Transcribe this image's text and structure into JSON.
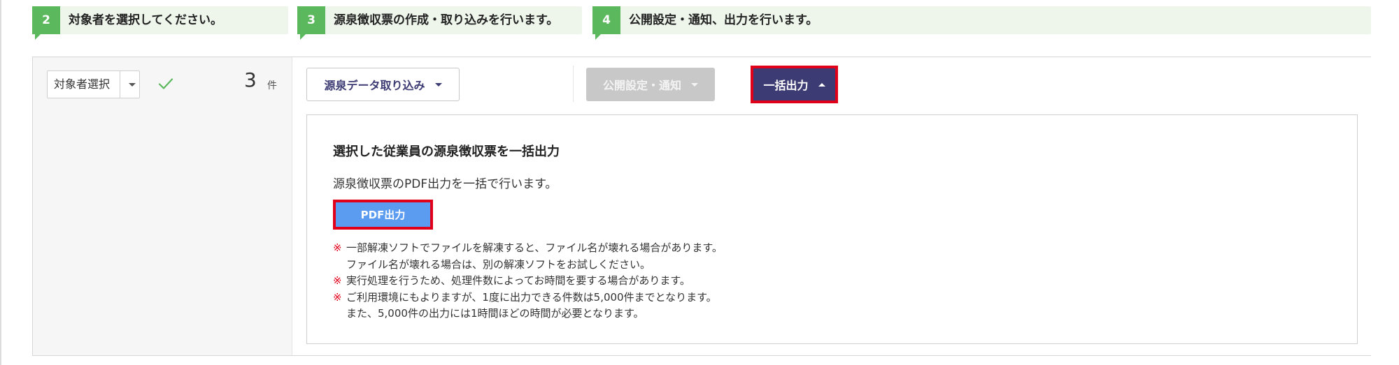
{
  "steps": [
    {
      "num": "2",
      "label": "対象者を選択してください。"
    },
    {
      "num": "3",
      "label": "源泉徴収票の作成・取り込みを行います。"
    },
    {
      "num": "4",
      "label": "公開設定・通知、出力を行います。"
    }
  ],
  "left": {
    "select_label": "対象者選択",
    "count": "3",
    "count_unit": "件"
  },
  "toolbar": {
    "import_label": "源泉データ取り込み",
    "publish_label": "公開設定・通知",
    "bulk_label": "一括出力"
  },
  "panel": {
    "title": "選択した従業員の源泉徴収票を一括出力",
    "description": "源泉徴収票のPDF出力を一括で行います。",
    "pdf_button": "PDF出力",
    "note_mark": "※",
    "notes": [
      "一部解凍ソフトでファイルを解凍すると、ファイル名が壊れる場合があります。",
      "ファイル名が壊れる場合は、別の解凍ソフトをお試しください。",
      "実行処理を行うため、処理件数によってお時間を要する場合があります。",
      "ご利用環境にもよりますが、1度に出力できる件数は5,000件までとなります。",
      "また、5,000件の出力には1時間ほどの時間が必要となります。"
    ]
  },
  "colors": {
    "step_green": "#5cb85c",
    "step_bg": "#eef6ec",
    "primary_navy": "#3d3b73",
    "highlight_red": "#e0001a",
    "pdf_blue": "#5b9bf0",
    "check_green": "#5cb85c"
  },
  "icons": {
    "check": "check-icon",
    "dropdown": "chevron-down-icon",
    "collapse": "chevron-up-icon"
  }
}
